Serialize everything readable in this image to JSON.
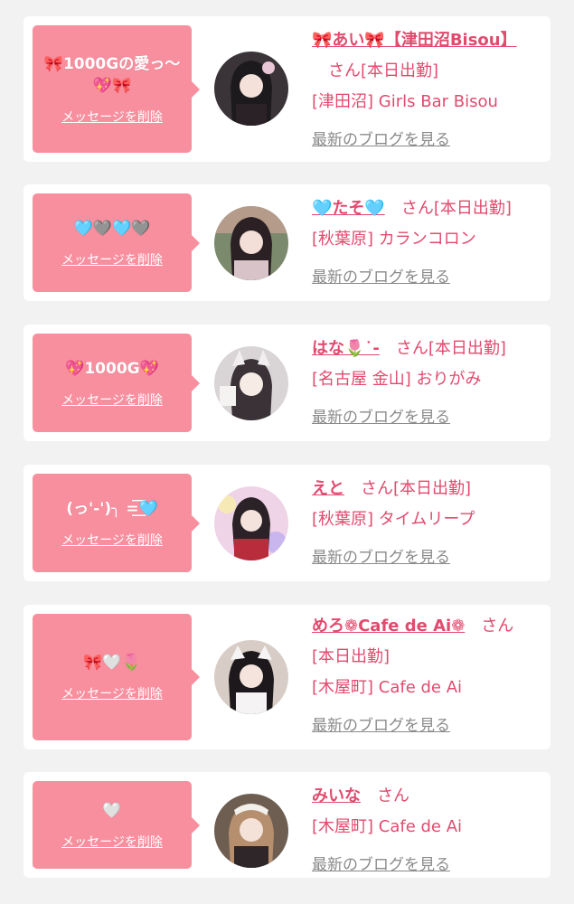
{
  "accent_color": "#f88f9f",
  "name_color": "#e24a6e",
  "messages": [
    {
      "bubble_text": "🎀1000Gの愛っ〜💖🎀",
      "delete_label": "メッセージを削除",
      "avatar": "girl-avatar",
      "name": "🎀あい🎀【津田沼Bisou】",
      "honorific": "さん",
      "status": "[本日出勤]",
      "shop": "[津田沼] Girls Bar Bisou",
      "blog_label": "最新のブログを見る"
    },
    {
      "bubble_text": "🩵🩶🩵🩶",
      "delete_label": "メッセージを削除",
      "avatar": "girl-avatar",
      "name": "🩵たそ🩵",
      "honorific": "さん",
      "status": "[本日出勤]",
      "shop": "[秋葉原] カランコロン",
      "blog_label": "最新のブログを見る"
    },
    {
      "bubble_text": "💖1000G💖",
      "delete_label": "メッセージを削除",
      "avatar": "girl-avatar",
      "name": "はな🌷˙-",
      "honorific": "さん",
      "status": "[本日出勤]",
      "shop": "[名古屋 金山] おりがみ",
      "blog_label": "最新のブログを見る"
    },
    {
      "bubble_text": "(っ'-')╮ =͟͟͞͞🩵",
      "delete_label": "メッセージを削除",
      "avatar": "girl-avatar",
      "name": "えと",
      "honorific": "さん",
      "status": "[本日出勤]",
      "shop": "[秋葉原] タイムリープ",
      "blog_label": "最新のブログを見る"
    },
    {
      "bubble_text": "🎀🤍🌷",
      "delete_label": "メッセージを削除",
      "avatar": "girl-avatar",
      "name": "めろ❁Cafe de Ai❁",
      "honorific": "さん",
      "status": "[本日出勤]",
      "shop": "[木屋町] Cafe de Ai",
      "blog_label": "最新のブログを見る"
    },
    {
      "bubble_text": "🤍",
      "delete_label": "メッセージを削除",
      "avatar": "girl-avatar",
      "name": "みいな",
      "honorific": "さん",
      "status": "[本日出勤]",
      "shop": "[木屋町] Cafe de Ai",
      "blog_label": "最新のブログを見る"
    }
  ]
}
